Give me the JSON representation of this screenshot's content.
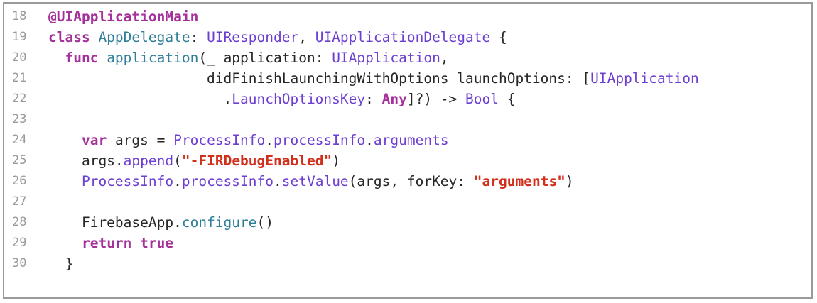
{
  "colors": {
    "keyword": "#a5329b",
    "type": "#6d3fd1",
    "function": "#2f7f99",
    "string": "#d12f1b",
    "plain": "#262626",
    "line_number": "#9a9a9a",
    "border": "#9a9a9a"
  },
  "lines": [
    {
      "number": "18",
      "tokens": [
        {
          "text": "@UIApplicationMain",
          "kind": "kw"
        }
      ]
    },
    {
      "number": "19",
      "tokens": [
        {
          "text": "class",
          "kind": "kw"
        },
        {
          "text": " AppDelegate",
          "kind": "fn"
        },
        {
          "text": ": ",
          "kind": "pl"
        },
        {
          "text": "UIResponder",
          "kind": "ty"
        },
        {
          "text": ", ",
          "kind": "pl"
        },
        {
          "text": "UIApplicationDelegate",
          "kind": "ty"
        },
        {
          "text": " {",
          "kind": "pl"
        }
      ]
    },
    {
      "number": "20",
      "tokens": [
        {
          "text": "  ",
          "kind": "pl"
        },
        {
          "text": "func",
          "kind": "kw"
        },
        {
          "text": " application",
          "kind": "fn"
        },
        {
          "text": "(_ application: ",
          "kind": "pl"
        },
        {
          "text": "UIApplication",
          "kind": "ty"
        },
        {
          "text": ",",
          "kind": "pl"
        }
      ]
    },
    {
      "number": "21",
      "tokens": [
        {
          "text": "                   didFinishLaunchingWithOptions launchOptions: [",
          "kind": "pl"
        },
        {
          "text": "UIApplication",
          "kind": "ty"
        }
      ]
    },
    {
      "number": "22",
      "tokens": [
        {
          "text": "                     .",
          "kind": "pl"
        },
        {
          "text": "LaunchOptionsKey",
          "kind": "ty"
        },
        {
          "text": ": ",
          "kind": "pl"
        },
        {
          "text": "Any",
          "kind": "kw"
        },
        {
          "text": "]?) -> ",
          "kind": "pl"
        },
        {
          "text": "Bool",
          "kind": "ty"
        },
        {
          "text": " {",
          "kind": "pl"
        }
      ]
    },
    {
      "number": "23",
      "tokens": []
    },
    {
      "number": "24",
      "tokens": [
        {
          "text": "    ",
          "kind": "pl"
        },
        {
          "text": "var",
          "kind": "kw"
        },
        {
          "text": " args = ",
          "kind": "pl"
        },
        {
          "text": "ProcessInfo",
          "kind": "ty"
        },
        {
          "text": ".",
          "kind": "pl"
        },
        {
          "text": "processInfo",
          "kind": "ty"
        },
        {
          "text": ".",
          "kind": "pl"
        },
        {
          "text": "arguments",
          "kind": "ty"
        }
      ]
    },
    {
      "number": "25",
      "tokens": [
        {
          "text": "    args.",
          "kind": "pl"
        },
        {
          "text": "append",
          "kind": "ty"
        },
        {
          "text": "(",
          "kind": "pl"
        },
        {
          "text": "\"-FIRDebugEnabled\"",
          "kind": "str"
        },
        {
          "text": ")",
          "kind": "pl"
        }
      ]
    },
    {
      "number": "26",
      "tokens": [
        {
          "text": "    ",
          "kind": "pl"
        },
        {
          "text": "ProcessInfo",
          "kind": "ty"
        },
        {
          "text": ".",
          "kind": "pl"
        },
        {
          "text": "processInfo",
          "kind": "ty"
        },
        {
          "text": ".",
          "kind": "pl"
        },
        {
          "text": "setValue",
          "kind": "ty"
        },
        {
          "text": "(args, forKey: ",
          "kind": "pl"
        },
        {
          "text": "\"arguments\"",
          "kind": "str"
        },
        {
          "text": ")",
          "kind": "pl"
        }
      ]
    },
    {
      "number": "27",
      "tokens": []
    },
    {
      "number": "28",
      "tokens": [
        {
          "text": "    FirebaseApp.",
          "kind": "pl"
        },
        {
          "text": "configure",
          "kind": "fn"
        },
        {
          "text": "()",
          "kind": "pl"
        }
      ]
    },
    {
      "number": "29",
      "tokens": [
        {
          "text": "    ",
          "kind": "pl"
        },
        {
          "text": "return",
          "kind": "kw"
        },
        {
          "text": " ",
          "kind": "pl"
        },
        {
          "text": "true",
          "kind": "kw"
        }
      ]
    },
    {
      "number": "30",
      "tokens": [
        {
          "text": "  }",
          "kind": "pl"
        }
      ]
    }
  ]
}
